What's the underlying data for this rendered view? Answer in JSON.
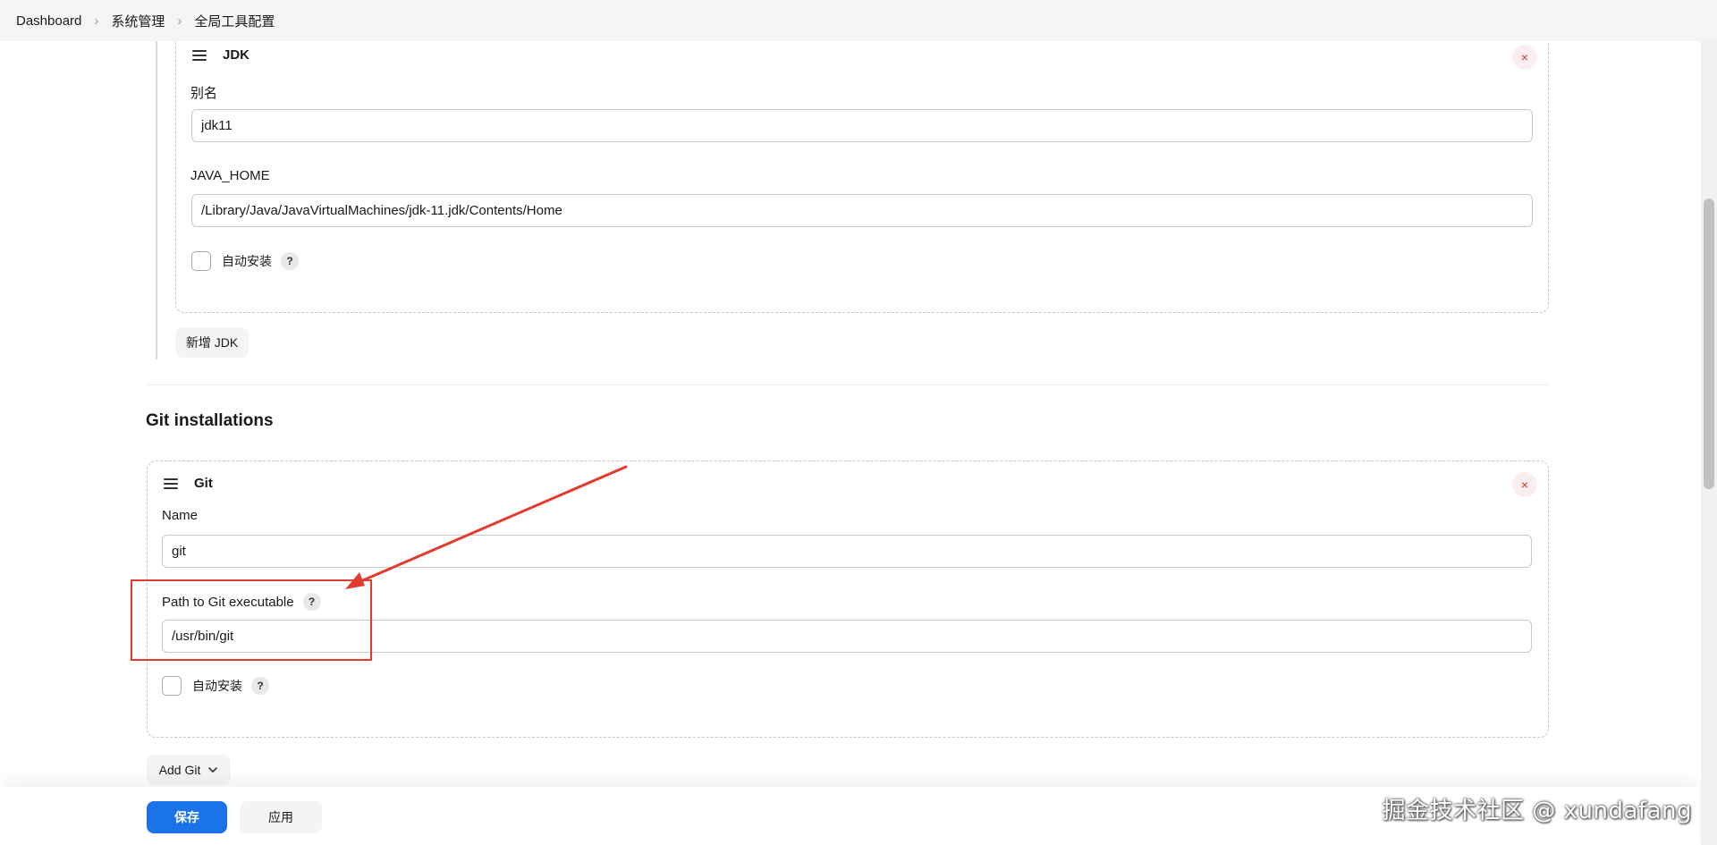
{
  "breadcrumb": {
    "items": [
      "Dashboard",
      "系统管理",
      "全局工具配置"
    ],
    "separator": "›"
  },
  "jdk": {
    "block_title": "JDK",
    "alias_label": "别名",
    "alias_value": "jdk11",
    "java_home_label": "JAVA_HOME",
    "java_home_value": "/Library/Java/JavaVirtualMachines/jdk-11.jdk/Contents/Home",
    "auto_install_label": "自动安装",
    "add_button_label": "新增 JDK"
  },
  "git": {
    "section_title": "Git installations",
    "block_title": "Git",
    "name_label": "Name",
    "name_value": "git",
    "path_label": "Path to Git executable",
    "path_value": "/usr/bin/git",
    "auto_install_label": "自动安装",
    "add_button_label": "Add Git"
  },
  "common": {
    "help_symbol": "?",
    "close_symbol": "×",
    "chevron_symbol": "⌄"
  },
  "footer": {
    "save_label": "保存",
    "apply_label": "应用"
  },
  "watermark": {
    "text": "掘金技术社区 @ xundafang"
  },
  "colors": {
    "primary": "#1a73e8",
    "danger": "#d9302f",
    "annotation": "#e23b30"
  }
}
